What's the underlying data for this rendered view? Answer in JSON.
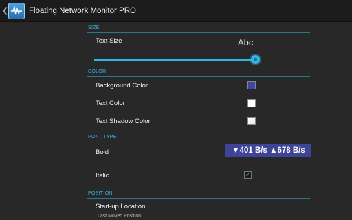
{
  "app": {
    "title": "Floating Network Monitor PRO"
  },
  "sections": {
    "size": "SIZE",
    "color": "COLOR",
    "font_type": "FONT TYPE",
    "position": "POSITION"
  },
  "size": {
    "text_size_label": "Text Size",
    "preview": "Abc",
    "slider_level": 0.98
  },
  "color": {
    "background_label": "Background Color",
    "background_value": "#3e46a8",
    "text_label": "Text Color",
    "text_value": "#ffffff",
    "shadow_label": "Text Shadow Color",
    "shadow_value": "#e6e6e6"
  },
  "font_type": {
    "bold_label": "Bold",
    "bold_checked": false,
    "speed_preview": "▼401 B/s ▲678 B/s",
    "italic_label": "Italic",
    "italic_checked": true
  },
  "position": {
    "startup_label": "Start-up Location",
    "startup_value": "Last Moved Position"
  },
  "colors": {
    "accent": "#33b5e5",
    "background": "#282828"
  }
}
